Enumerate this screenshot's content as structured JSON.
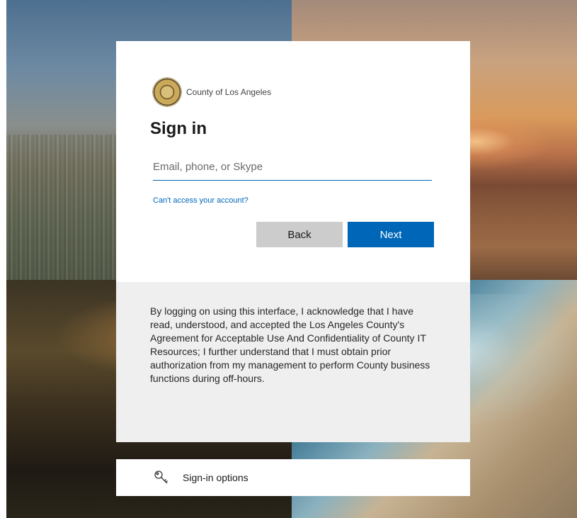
{
  "brand": {
    "name": "County of Los Angeles"
  },
  "signin": {
    "title": "Sign in",
    "email_placeholder": "Email, phone, or Skype",
    "email_value": "",
    "cant_access": "Can't access your account?",
    "back_label": "Back",
    "next_label": "Next"
  },
  "disclaimer": {
    "text": "By logging on using this interface, I acknowledge that I have read, understood, and accepted the Los Angeles County's Agreement for Acceptable Use And Confidentiality of County IT Resources; I further understand that I must obtain prior authorization from my management to perform County business functions during off-hours."
  },
  "options": {
    "label": "Sign-in options",
    "icon": "key-icon"
  },
  "colors": {
    "accent": "#0067b8",
    "back_button": "#cccccc",
    "panel": "#efefef"
  }
}
